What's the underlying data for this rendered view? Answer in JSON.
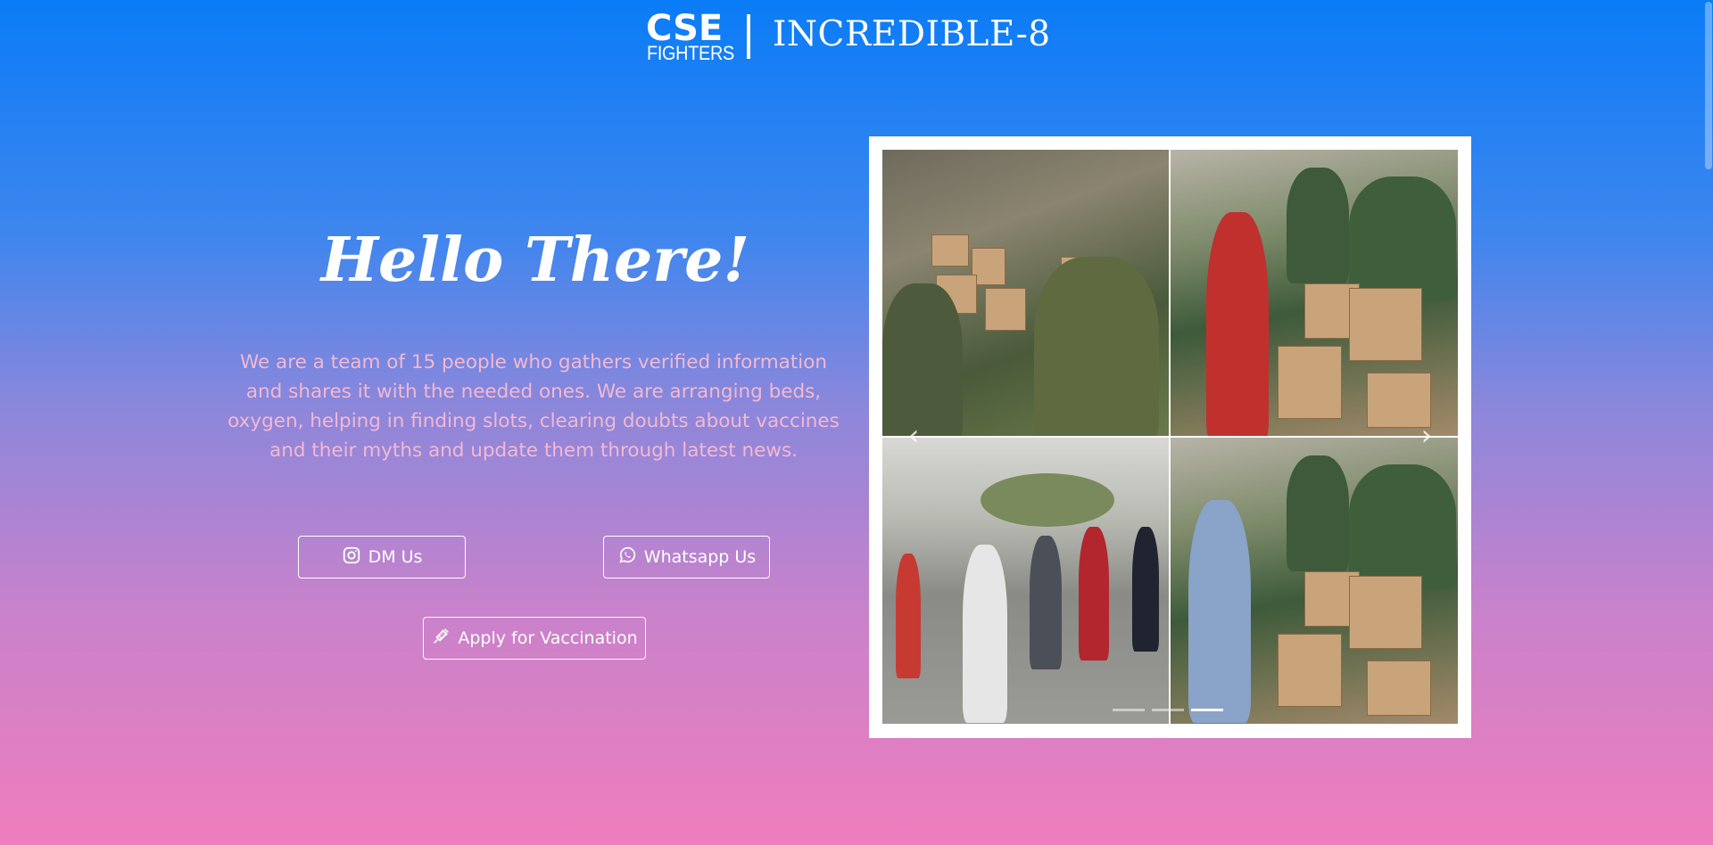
{
  "header": {
    "logo_top": "CSE",
    "logo_bottom": "FIGHTERS",
    "title": "INCREDIBLE-8"
  },
  "hero": {
    "heading": "Hello There!",
    "description": "We are a team of 15 people who gathers verified information and shares it with the needed ones. We are arranging beds, oxygen, helping in finding slots, clearing doubts about vaccines and their myths and update them through latest news."
  },
  "buttons": {
    "dm_label": "DM Us",
    "dm_icon": "instagram-icon",
    "whatsapp_label": "Whatsapp Us",
    "whatsapp_icon": "whatsapp-icon",
    "vaccination_label": "Apply for Vaccination",
    "vaccination_icon": "syringe-icon"
  },
  "carousel": {
    "prev_icon": "chevron-left-icon",
    "next_icon": "chevron-right-icon",
    "slide_count": 3,
    "active_slide": 3
  },
  "colors": {
    "gradient_top": "#0a7cf7",
    "gradient_bottom": "#f07dbd",
    "description_text": "#f3b8d2"
  }
}
